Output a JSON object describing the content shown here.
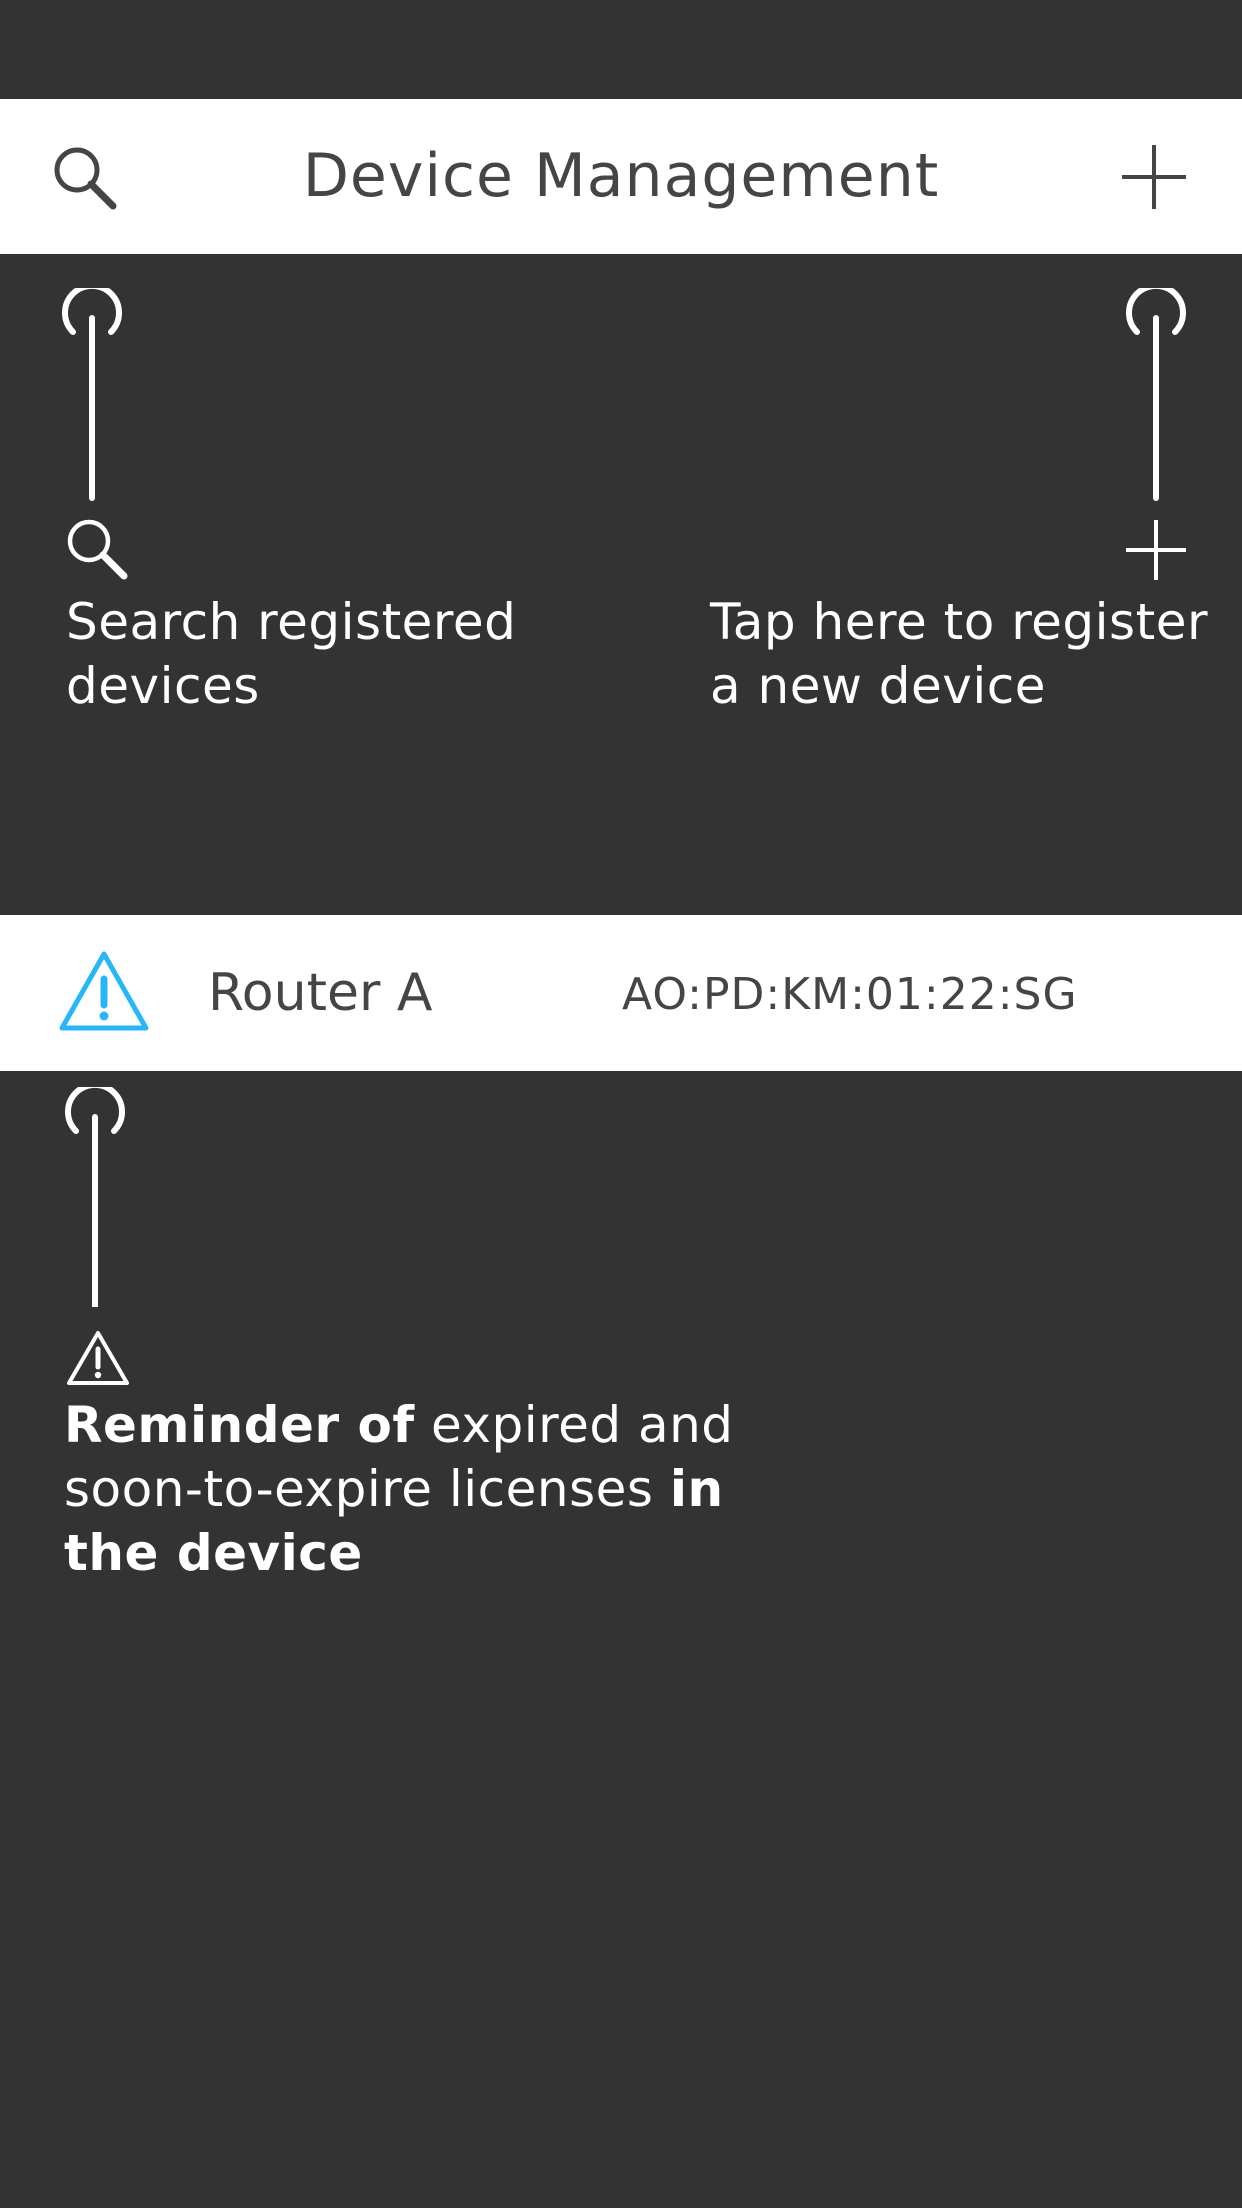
{
  "header": {
    "title": "Device Management",
    "search_icon": "search-icon",
    "add_icon": "plus-icon"
  },
  "hints": {
    "search": {
      "icon": "search-icon",
      "text": "Search registered\ndevices"
    },
    "register": {
      "icon": "plus-icon",
      "text": "Tap here to register\na new device"
    },
    "reminder": {
      "icon": "warning-icon",
      "bold_1": "Reminder of",
      "normal_1": " expired  and\nsoon-to-expire licenses ",
      "bold_2": "in\nthe device"
    }
  },
  "device": {
    "status_icon": "warning-icon",
    "name": "Router A",
    "mac": "AO:PD:KM:01:22:SG"
  },
  "colors": {
    "overlay": "#333333",
    "header_bg": "#ffffff",
    "text_dark": "#454545",
    "warning_accent": "#29b6f6"
  }
}
